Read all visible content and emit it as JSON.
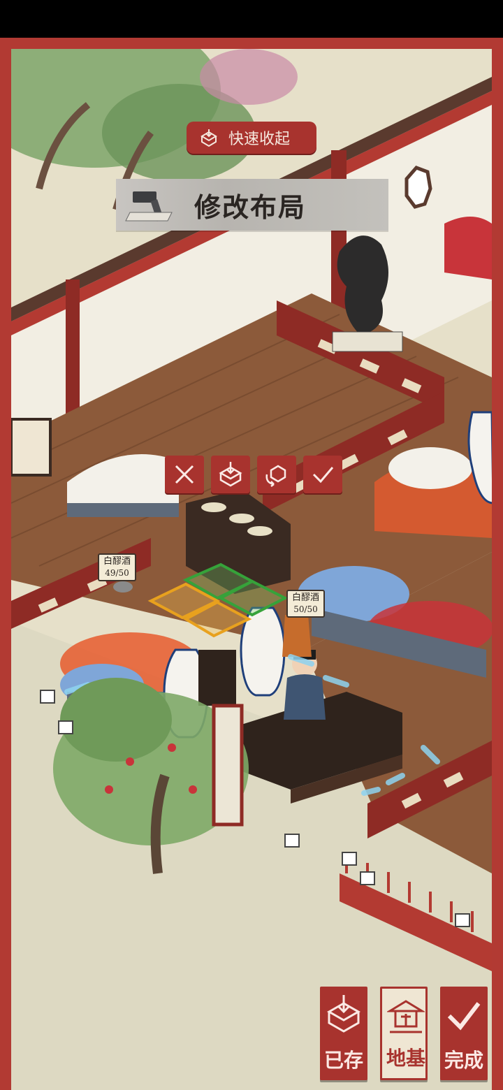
{
  "top_overlay": {
    "collapse_label": "快速收起",
    "title": "修改布局"
  },
  "edit_actions": [
    {
      "icon": "cancel-x-icon"
    },
    {
      "icon": "store-box-icon"
    },
    {
      "icon": "rotate-icon"
    },
    {
      "icon": "confirm-check-icon"
    }
  ],
  "item_tags": [
    {
      "name": "白醪酒",
      "count": "49/50"
    },
    {
      "name": "白醪酒",
      "count": "50/50"
    }
  ],
  "bottom_bar": {
    "stored_label": "已存",
    "foundation_label": "地基",
    "done_label": "完成"
  },
  "colors": {
    "frame": "#b23a33",
    "button": "#a8332e",
    "floor": "#8c5a3a",
    "wall": "#f2eee3"
  }
}
